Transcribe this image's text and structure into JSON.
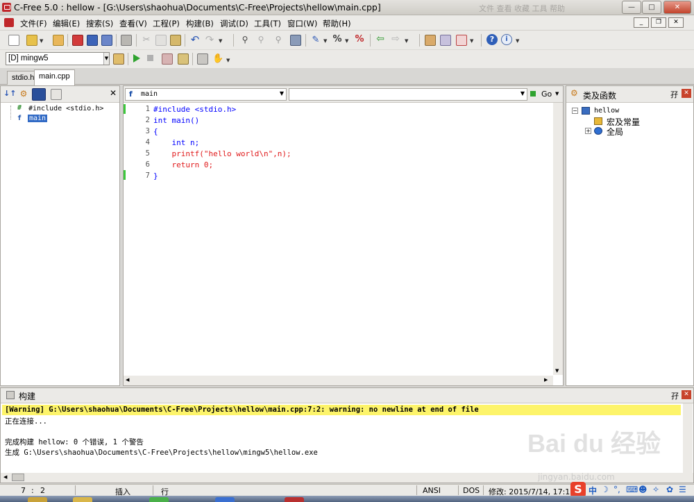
{
  "window": {
    "title": "C-Free 5.0 : hellow - [G:\\Users\\shaohua\\Documents\\C-Free\\Projects\\hellow\\main.cpp]",
    "ghost_menu": "文件   查看   收藏   工具   帮助",
    "controls": {
      "minimize": "—",
      "maximize": "□",
      "close": "✕"
    }
  },
  "menu": {
    "items": [
      "文件(F)",
      "编辑(E)",
      "搜索(S)",
      "查看(V)",
      "工程(P)",
      "构建(B)",
      "调试(D)",
      "工具(T)",
      "窗口(W)",
      "帮助(H)"
    ],
    "mdi": {
      "minimize": "_",
      "restore": "❐",
      "close": "✕"
    }
  },
  "toolbar2": {
    "compiler": "[D] mingw5"
  },
  "tabs": [
    {
      "label": "stdio.h",
      "active": false
    },
    {
      "label": "main.cpp",
      "active": true
    }
  ],
  "left_panel": {
    "tree": [
      {
        "icon": "#",
        "label": "#include <stdio.h>"
      },
      {
        "icon": "f",
        "label": "main",
        "selected": true
      }
    ]
  },
  "editor": {
    "function_combo": "main",
    "go_label": "Go",
    "lines": [
      {
        "n": "1",
        "text": "#include <stdio.h>"
      },
      {
        "n": "2",
        "text": "int main()"
      },
      {
        "n": "3",
        "text": "{"
      },
      {
        "n": "4",
        "text": "    int n;"
      },
      {
        "n": "5",
        "text": "    printf(\"hello world\\n\",n);"
      },
      {
        "n": "6",
        "text": "    return 0;"
      },
      {
        "n": "7",
        "text": "}"
      }
    ]
  },
  "right_panel": {
    "title": "类及函数",
    "pin": "孖",
    "tree": [
      {
        "label": "hellow"
      },
      {
        "label": "宏及常量"
      },
      {
        "label": "全局"
      }
    ]
  },
  "build": {
    "title": "构建",
    "pin": "孖",
    "lines": [
      "[Warning] G:\\Users\\shaohua\\Documents\\C-Free\\Projects\\hellow\\main.cpp:7:2: warning: no newline at end of file",
      "正在连接...",
      "",
      "完成构建 hellow: 0 个错误, 1 个警告",
      "生成 G:\\Users\\shaohua\\Documents\\C-Free\\Projects\\hellow\\mingw5\\hellow.exe"
    ]
  },
  "status": {
    "line": "7",
    "col": "2",
    "insert": "插入",
    "row_mode": "行",
    "encoding": "ANSI",
    "line_ending": "DOS",
    "modified": "修改: 2015/7/14, 17:17"
  },
  "watermark": {
    "text": "Bai du 经验",
    "url": "jingyan.baidu.com"
  },
  "colors": {
    "warning_bg": "#fdf46a",
    "keyword": "#0000ff",
    "return_kw": "#e0191a",
    "selection": "#316ac5"
  }
}
